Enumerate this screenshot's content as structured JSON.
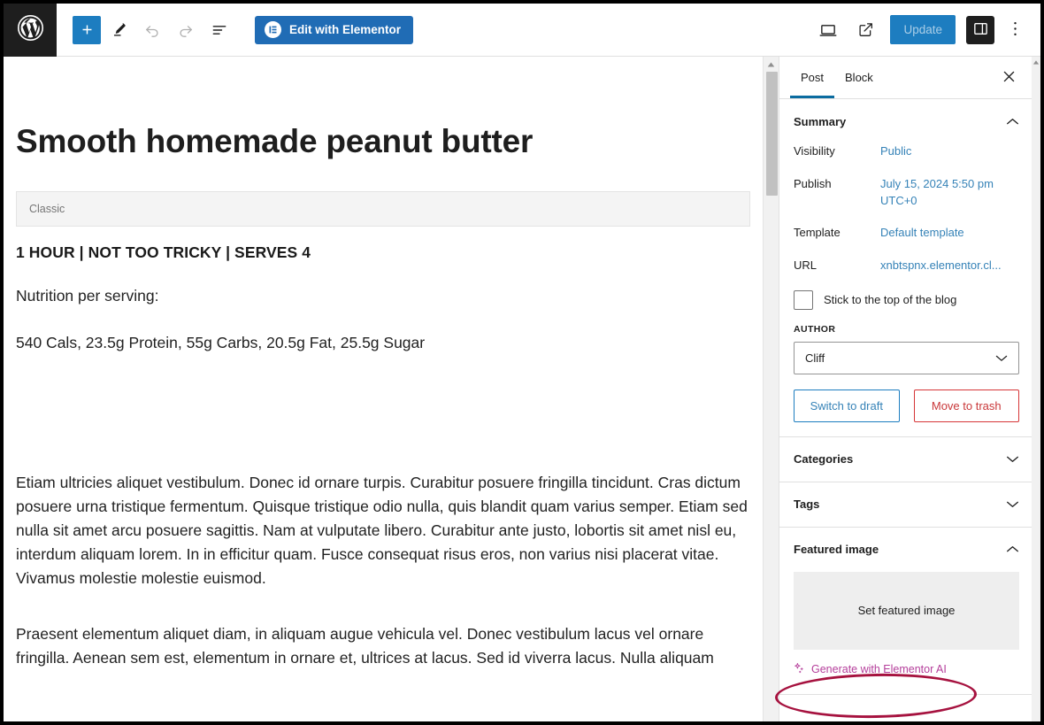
{
  "topbar": {
    "wp_logo_label": "WordPress",
    "add_block_label": "+",
    "tools": [
      {
        "name": "add-block-button",
        "icon": "plus-icon"
      },
      {
        "name": "edit-tool-button",
        "icon": "pencil-icon"
      },
      {
        "name": "undo-button",
        "icon": "undo-icon"
      },
      {
        "name": "redo-button",
        "icon": "redo-icon"
      },
      {
        "name": "document-overview-button",
        "icon": "list-view-icon"
      }
    ],
    "elementor_button_label": "Edit with Elementor",
    "elementor_icon": "elementor-logo-icon",
    "view_icon": "desktop-preview-icon",
    "external_icon": "view-post-external-icon",
    "update_label": "Update",
    "sidebar_toggle_icon": "settings-panel-icon",
    "options_icon": "kebab-menu-icon",
    "accent_blue": "#1d7dc0",
    "elementor_blue": "#206cb5"
  },
  "editor": {
    "post_title": "Smooth homemade peanut butter",
    "classic_block_label": "Classic",
    "recipe_meta": "1 HOUR | NOT TOO TRICKY | SERVES 4",
    "nutrition_heading": "Nutrition per serving:",
    "nutrition_values": "540 Cals, 23.5g Protein, 55g Carbs, 20.5g Fat, 25.5g Sugar",
    "paragraph_1": "Etiam ultricies aliquet vestibulum. Donec id ornare turpis. Curabitur posuere fringilla tincidunt. Cras dictum posuere urna tristique fermentum. Quisque tristique odio nulla, quis blandit quam varius semper. Etiam sed nulla sit amet arcu posuere sagittis. Nam at vulputate libero. Curabitur ante justo, lobortis sit amet nisl eu, interdum aliquam lorem. In in efficitur quam. Fusce consequat risus eros, non varius nisi placerat vitae. Vivamus molestie molestie euismod.",
    "paragraph_2": "Praesent elementum aliquet diam, in aliquam augue vehicula vel. Donec vestibulum lacus vel ornare fringilla. Aenean sem est, elementum in ornare et, ultrices at lacus. Sed id viverra lacus. Nulla aliquam"
  },
  "settings": {
    "tabs": [
      {
        "label": "Post",
        "active": true
      },
      {
        "label": "Block",
        "active": false
      }
    ],
    "close_icon": "close-icon",
    "summary": {
      "title": "Summary",
      "expanded": true,
      "rows": [
        {
          "label": "Visibility",
          "value": "Public"
        },
        {
          "label": "Publish",
          "value": "July 15, 2024 5:50 pm UTC+0"
        },
        {
          "label": "Template",
          "value": "Default template"
        },
        {
          "label": "URL",
          "value": "xnbtspnx.elementor.cl..."
        }
      ],
      "sticky_label": "Stick to the top of the blog",
      "sticky_checked": false,
      "author_label": "AUTHOR",
      "author_value": "Cliff",
      "switch_to_draft_label": "Switch to draft",
      "move_to_trash_label": "Move to trash"
    },
    "categories": {
      "title": "Categories",
      "expanded": false
    },
    "tags": {
      "title": "Tags",
      "expanded": false
    },
    "featured_image": {
      "title": "Featured image",
      "expanded": true,
      "placeholder_label": "Set featured image",
      "ai_link_label": "Generate with Elementor AI",
      "ai_icon": "sparkles-icon",
      "ai_color": "#b53f9b"
    }
  },
  "annotation": {
    "shape": "ellipse-highlight",
    "color": "#a6123f",
    "target": "Generate with Elementor AI"
  }
}
